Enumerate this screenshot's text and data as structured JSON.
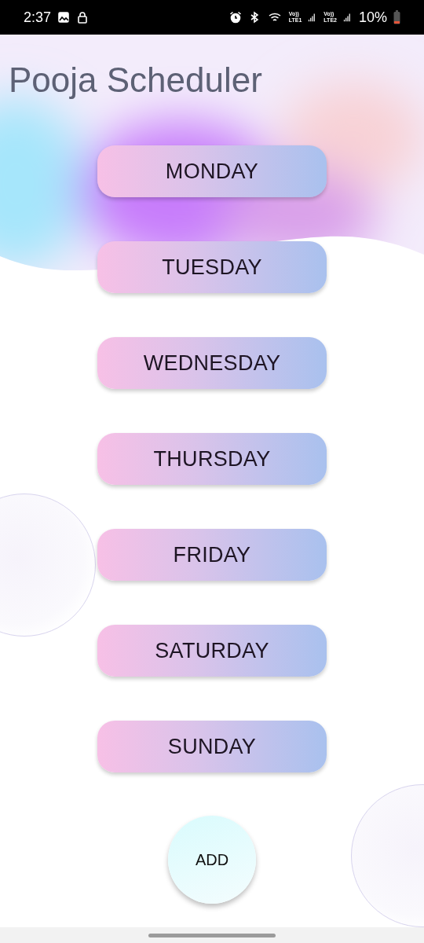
{
  "status_bar": {
    "time": "2:37",
    "sim_labels": [
      {
        "top": "Vo))",
        "bottom": "LTE1"
      },
      {
        "top": "Vo))",
        "bottom": "LTE2"
      }
    ],
    "battery": "10%"
  },
  "app": {
    "title": "Pooja Scheduler"
  },
  "days": [
    {
      "label": "MONDAY"
    },
    {
      "label": "TUESDAY"
    },
    {
      "label": "WEDNESDAY"
    },
    {
      "label": "THURSDAY"
    },
    {
      "label": "FRIDAY"
    },
    {
      "label": "SATURDAY"
    },
    {
      "label": "SUNDAY"
    }
  ],
  "add_button": {
    "label": "ADD"
  }
}
